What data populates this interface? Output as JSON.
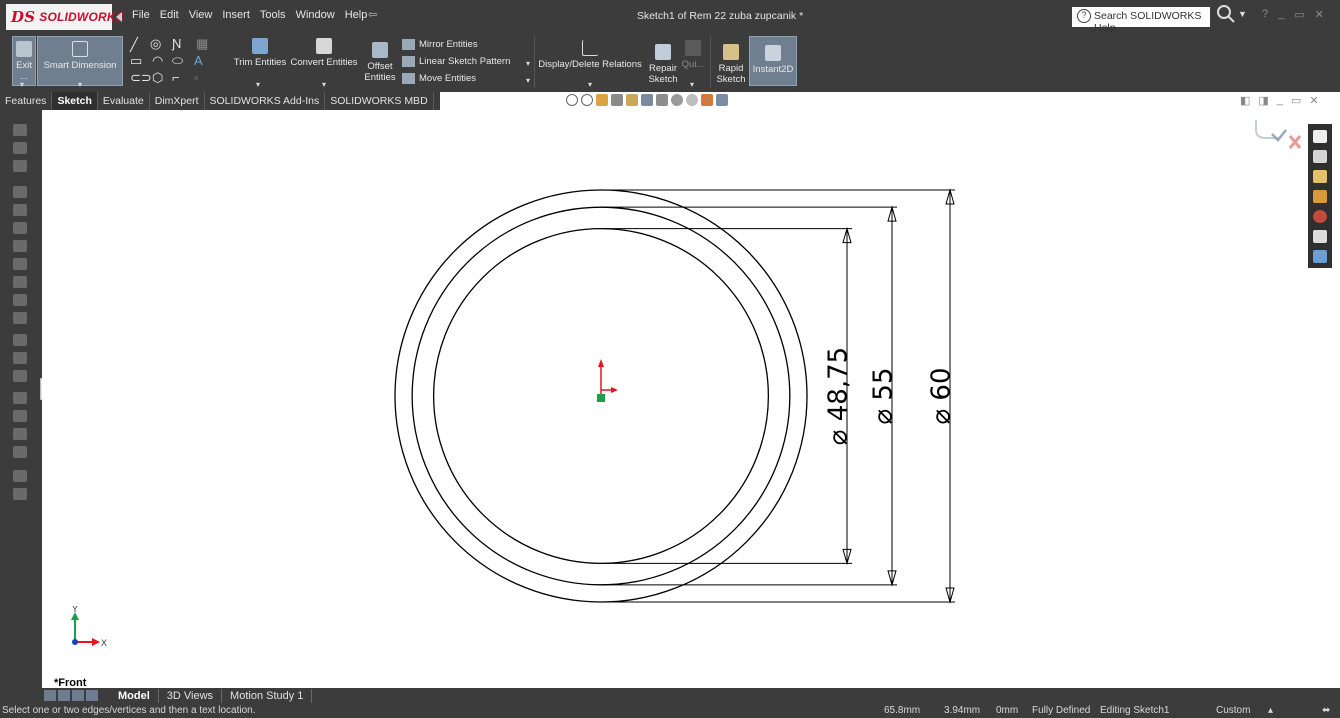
{
  "app": {
    "logo_text": "SOLIDWORKS",
    "logo_mark": "DS",
    "document_title": "Sketch1 of Rem 22 zuba zupcanik *"
  },
  "menu": [
    "File",
    "Edit",
    "View",
    "Insert",
    "Tools",
    "Window",
    "Help"
  ],
  "help_search": {
    "placeholder": "Search SOLIDWORKS Help"
  },
  "ribbon": {
    "exit_sketch": "Exit ...",
    "smart_dimension": "Smart Dimension",
    "trim_entities": "Trim Entities",
    "convert_entities": "Convert Entities",
    "offset_entities_1": "Offset",
    "offset_entities_2": "Entities",
    "mirror_entities": "Mirror Entities",
    "linear_sketch_pattern": "Linear Sketch Pattern",
    "move_entities": "Move Entities",
    "display_delete_relations": "Display/Delete Relations",
    "repair_sketch_1": "Repair",
    "repair_sketch_2": "Sketch",
    "quick_snaps": "Qui...",
    "rapid_sketch_1": "Rapid",
    "rapid_sketch_2": "Sketch",
    "instant2d": "Instant2D"
  },
  "tabs": [
    "Features",
    "Sketch",
    "Evaluate",
    "DimXpert",
    "SOLIDWORKS Add-Ins",
    "SOLIDWORKS MBD"
  ],
  "active_tab": "Sketch",
  "sketch": {
    "dimensions": [
      {
        "symbol": "⌀",
        "value": "48,75",
        "diameter": 48.75
      },
      {
        "symbol": "⌀",
        "value": "55",
        "diameter": 55
      },
      {
        "symbol": "⌀",
        "value": "60",
        "diameter": 60
      }
    ],
    "triad": {
      "x_label": "X",
      "y_label": "Y"
    },
    "view_name": "*Front"
  },
  "bottom_tabs": [
    "Model",
    "3D Views",
    "Motion Study 1"
  ],
  "active_bottom_tab": "Model",
  "status": {
    "message": "Select one or two edges/vertices and then a text location.",
    "x_coord": "65.8mm",
    "y_coord": "3.94mm",
    "z_coord": "0mm",
    "state": "Fully Defined",
    "editing": "Editing Sketch1",
    "units": "Custom"
  },
  "colors": {
    "chrome": "#3c3c3c",
    "canvas": "#ffffff",
    "origin_red": "#e8141b",
    "origin_green": "#1aa04a",
    "triad_blue": "#1f3fbf"
  }
}
